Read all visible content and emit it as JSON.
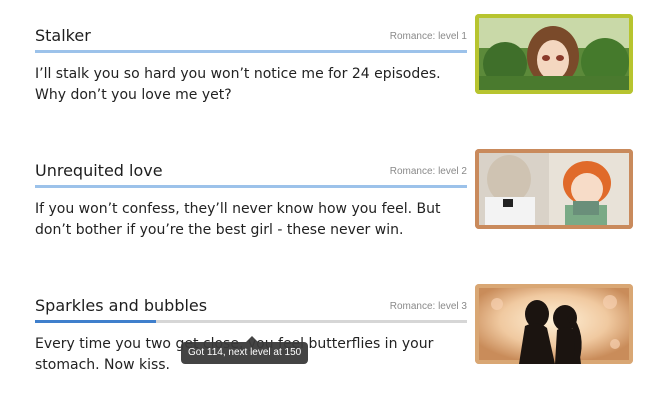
{
  "achievements": [
    {
      "title": "Stalker",
      "level": "Romance: level 1",
      "description": "I’ll stalk you so hard you won’t notice me for 24 episodes. Why don’t you love me yet?",
      "progress": 1.0,
      "frame_color": "#b7c42f"
    },
    {
      "title": "Unrequited love",
      "level": "Romance: level 2",
      "description": "If you won’t confess, they’ll never know how you feel. But don’t bother if you’re the best girl - these never win.",
      "progress": 1.0,
      "frame_color": "#c98a5c"
    },
    {
      "title": "Sparkles and bubbles",
      "level": "Romance: level 3",
      "description": "Every time you two get close, you feel butterflies in your stomach. Now kiss.",
      "progress": 0.28,
      "frame_color": "#d9a774"
    }
  ],
  "tooltip": {
    "text": "Got 114, next level at 150"
  }
}
